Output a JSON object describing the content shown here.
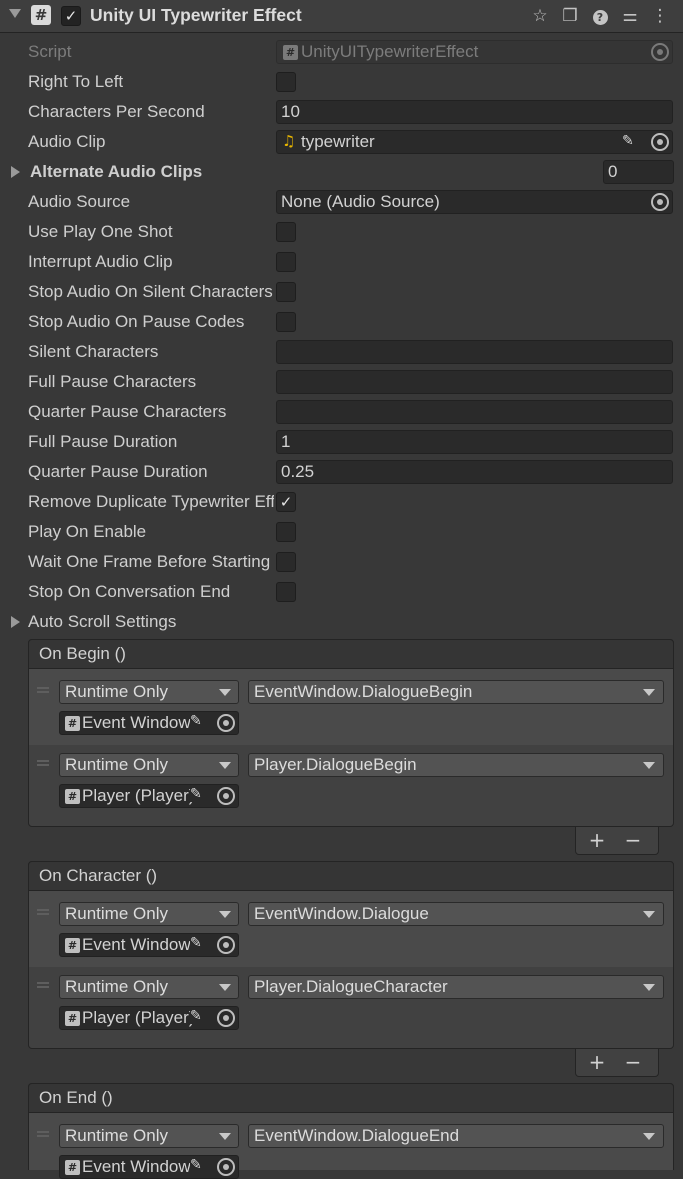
{
  "header": {
    "title": "Unity UI Typewriter Effect",
    "enabled_check": "✓",
    "script_icon_glyph": "#",
    "icons": [
      "star-icon",
      "copy-icon",
      "help-icon",
      "settings-sliders-icon",
      "more-icon"
    ]
  },
  "props": {
    "script": {
      "label": "Script",
      "value": "UnityUITypewriterEffect"
    },
    "right_to_left": {
      "label": "Right To Left"
    },
    "chars_per_second": {
      "label": "Characters Per Second",
      "value": "10"
    },
    "audio_clip": {
      "label": "Audio Clip",
      "value": "typewriter"
    },
    "alternate_clips": {
      "label": "Alternate Audio Clips",
      "count": "0"
    },
    "audio_source": {
      "label": "Audio Source",
      "value": "None (Audio Source)"
    },
    "use_play_one_shot": {
      "label": "Use Play One Shot"
    },
    "interrupt_audio_clip": {
      "label": "Interrupt Audio Clip"
    },
    "stop_audio_silent": {
      "label": "Stop Audio On Silent Characters"
    },
    "stop_audio_pause": {
      "label": "Stop Audio On Pause Codes"
    },
    "silent_chars": {
      "label": "Silent Characters",
      "value": ""
    },
    "full_pause_chars": {
      "label": "Full Pause Characters",
      "value": ""
    },
    "quarter_pause_chars": {
      "label": "Quarter Pause Characters",
      "value": ""
    },
    "full_pause_duration": {
      "label": "Full Pause Duration",
      "value": "1"
    },
    "quarter_pause_duration": {
      "label": "Quarter Pause Duration",
      "value": "0.25"
    },
    "remove_duplicate": {
      "label": "Remove Duplicate Typewriter Effects",
      "check": "✓"
    },
    "play_on_enable": {
      "label": "Play On Enable"
    },
    "wait_one_frame": {
      "label": "Wait One Frame Before Starting"
    },
    "stop_on_conversation_end": {
      "label": "Stop On Conversation End"
    },
    "auto_scroll": {
      "label": "Auto Scroll Settings"
    }
  },
  "events": {
    "on_begin": {
      "title": "On Begin ()",
      "entries": [
        {
          "mode": "Runtime Only",
          "function": "EventWindow.DialogueBegin",
          "target": "Event Window"
        },
        {
          "mode": "Runtime Only",
          "function": "Player.DialogueBegin",
          "target": "Player (Player)"
        }
      ]
    },
    "on_character": {
      "title": "On Character ()",
      "entries": [
        {
          "mode": "Runtime Only",
          "function": "EventWindow.Dialogue",
          "target": "Event Window"
        },
        {
          "mode": "Runtime Only",
          "function": "Player.DialogueCharacter",
          "target": "Player (Player)"
        }
      ]
    },
    "on_end": {
      "title": "On End ()",
      "entries": [
        {
          "mode": "Runtime Only",
          "function": "EventWindow.DialogueEnd",
          "target": "Event Window"
        }
      ]
    },
    "plus": "+",
    "minus": "−"
  }
}
